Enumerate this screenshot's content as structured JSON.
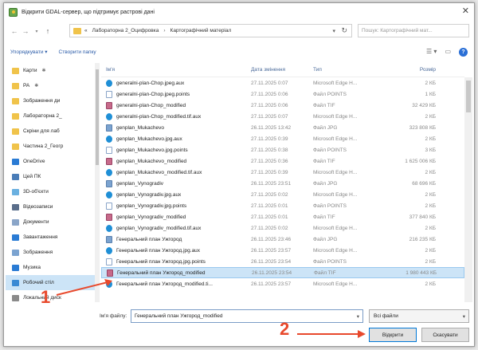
{
  "window": {
    "title": "Відкрити GDAL-сервер, що підтримує растрові дані",
    "close_glyph": "✕"
  },
  "nav": {
    "back": "←",
    "forward": "→",
    "up": "↑",
    "breadcrumbs": [
      "«",
      "Лабораторна 2_Оцифровка",
      "Картографічний матеріал"
    ],
    "search_placeholder": "Пошук: Картографічний мат..."
  },
  "toolbar": {
    "organize": "Упорядкувати ▾",
    "new_folder": "Створити папку"
  },
  "sidebar": {
    "items": [
      {
        "label": "Карти",
        "icon_color": "#f0c34a",
        "pinned": true,
        "selected": false
      },
      {
        "label": "PA",
        "icon_color": "#f0c34a",
        "pinned": true,
        "selected": false
      },
      {
        "label": "Зображення ди",
        "icon_color": "#f0c34a",
        "pinned": false,
        "selected": false
      },
      {
        "label": "Лабораторна 2_",
        "icon_color": "#f0c34a",
        "pinned": false,
        "selected": false
      },
      {
        "label": "Скріни для лаб",
        "icon_color": "#f0c34a",
        "pinned": false,
        "selected": false
      },
      {
        "label": "Частина 2_Геогр",
        "icon_color": "#f0c34a",
        "pinned": false,
        "selected": false
      },
      {
        "label": "OneDrive",
        "icon_color": "#2a7bd4",
        "pinned": false,
        "selected": false
      },
      {
        "label": "Цей ПК",
        "icon_color": "#4a7db8",
        "pinned": false,
        "selected": false
      },
      {
        "label": "3D-об'єкти",
        "icon_color": "#6ab0e0",
        "pinned": false,
        "selected": false
      },
      {
        "label": "Відеозаписи",
        "icon_color": "#5a6e8a",
        "pinned": false,
        "selected": false
      },
      {
        "label": "Документи",
        "icon_color": "#8aa5c8",
        "pinned": false,
        "selected": false
      },
      {
        "label": "Завантаження",
        "icon_color": "#2a7bd4",
        "pinned": false,
        "selected": false
      },
      {
        "label": "Зображення",
        "icon_color": "#7ba3d0",
        "pinned": false,
        "selected": false
      },
      {
        "label": "Музика",
        "icon_color": "#2a7bd4",
        "pinned": false,
        "selected": false
      },
      {
        "label": "Робочий стіл",
        "icon_color": "#3a8ad4",
        "pinned": false,
        "selected": true
      },
      {
        "label": "Локальний диск",
        "icon_color": "#8a8a8a",
        "pinned": false,
        "selected": false
      },
      {
        "label": "Локальний диск",
        "icon_color": "#8a8a8a",
        "pinned": false,
        "selected": false
      }
    ]
  },
  "list": {
    "headers": {
      "name": "Ім'я",
      "date": "Дата змінення",
      "type": "Тип",
      "size": "Розмір"
    },
    "rows": [
      {
        "name": "generalni-plan-Chop.jpeg.aux",
        "date": "27.11.2025 0:07",
        "type": "Microsoft Edge H...",
        "size": "2 КБ",
        "icon": "edge",
        "selected": false
      },
      {
        "name": "generalni-plan-Chop.jpeg.points",
        "date": "27.11.2025 0:06",
        "type": "Файл POINTS",
        "size": "1 КБ",
        "icon": "doc",
        "selected": false
      },
      {
        "name": "generalni-plan-Chop_modified",
        "date": "27.11.2025 0:06",
        "type": "Файл TIF",
        "size": "32 429 КБ",
        "icon": "tif",
        "selected": false
      },
      {
        "name": "generalni-plan-Chop_modified.tif.aux",
        "date": "27.11.2025 0:07",
        "type": "Microsoft Edge H...",
        "size": "2 КБ",
        "icon": "edge",
        "selected": false
      },
      {
        "name": "genplan_Mukachevo",
        "date": "26.11.2025 13:42",
        "type": "Файл JPG",
        "size": "323 808 КБ",
        "icon": "img",
        "selected": false
      },
      {
        "name": "genplan_Mukachevo.jpg.aux",
        "date": "27.11.2025 0:39",
        "type": "Microsoft Edge H...",
        "size": "2 КБ",
        "icon": "edge",
        "selected": false
      },
      {
        "name": "genplan_Mukachevo.jpg.points",
        "date": "27.11.2025 0:38",
        "type": "Файл POINTS",
        "size": "3 КБ",
        "icon": "doc",
        "selected": false
      },
      {
        "name": "genplan_Mukachevo_modified",
        "date": "27.11.2025 0:36",
        "type": "Файл TIF",
        "size": "1 625 006 КБ",
        "icon": "tif",
        "selected": false
      },
      {
        "name": "genplan_Mukachevo_modified.tif.aux",
        "date": "27.11.2025 0:39",
        "type": "Microsoft Edge H...",
        "size": "2 КБ",
        "icon": "edge",
        "selected": false
      },
      {
        "name": "genplan_Vynogradiv",
        "date": "26.11.2025 23:51",
        "type": "Файл JPG",
        "size": "68 696 КБ",
        "icon": "img",
        "selected": false
      },
      {
        "name": "genplan_Vynogradiv.jpg.aux",
        "date": "27.11.2025 0:02",
        "type": "Microsoft Edge H...",
        "size": "2 КБ",
        "icon": "edge",
        "selected": false
      },
      {
        "name": "genplan_Vynogradiv.jpg.points",
        "date": "27.11.2025 0:01",
        "type": "Файл POINTS",
        "size": "2 КБ",
        "icon": "doc",
        "selected": false
      },
      {
        "name": "genplan_Vynogradiv_modified",
        "date": "27.11.2025 0:01",
        "type": "Файл TIF",
        "size": "377 840 КБ",
        "icon": "tif",
        "selected": false
      },
      {
        "name": "genplan_Vynogradiv_modified.tif.aux",
        "date": "27.11.2025 0:02",
        "type": "Microsoft Edge H...",
        "size": "2 КБ",
        "icon": "edge",
        "selected": false
      },
      {
        "name": "Генеральний план Ужгород",
        "date": "26.11.2025 23:46",
        "type": "Файл JPG",
        "size": "216 235 КБ",
        "icon": "img",
        "selected": false
      },
      {
        "name": "Генеральний план Ужгород.jpg.aux",
        "date": "26.11.2025 23:57",
        "type": "Microsoft Edge H...",
        "size": "2 КБ",
        "icon": "edge",
        "selected": false
      },
      {
        "name": "Генеральний план Ужгород.jpg.points",
        "date": "26.11.2025 23:54",
        "type": "Файл POINTS",
        "size": "2 КБ",
        "icon": "doc",
        "selected": false
      },
      {
        "name": "Генеральний план Ужгород_modified",
        "date": "26.11.2025 23:54",
        "type": "Файл TIF",
        "size": "1 980 443 КБ",
        "icon": "tif",
        "selected": true
      },
      {
        "name": "Генеральний план Ужгород_modified.ti...",
        "date": "26.11.2025 23:57",
        "type": "Microsoft Edge H...",
        "size": "2 КБ",
        "icon": "edge",
        "selected": false
      }
    ]
  },
  "footer": {
    "filename_label": "Ім'я файлу:",
    "filename_value": "Генеральний план Ужгород_modified",
    "filetype_value": "Всі файли",
    "open_label": "Відкрити",
    "cancel_label": "Скасувати"
  },
  "annotations": {
    "step1": "1",
    "step2": "2",
    "color": "#e8492c"
  }
}
